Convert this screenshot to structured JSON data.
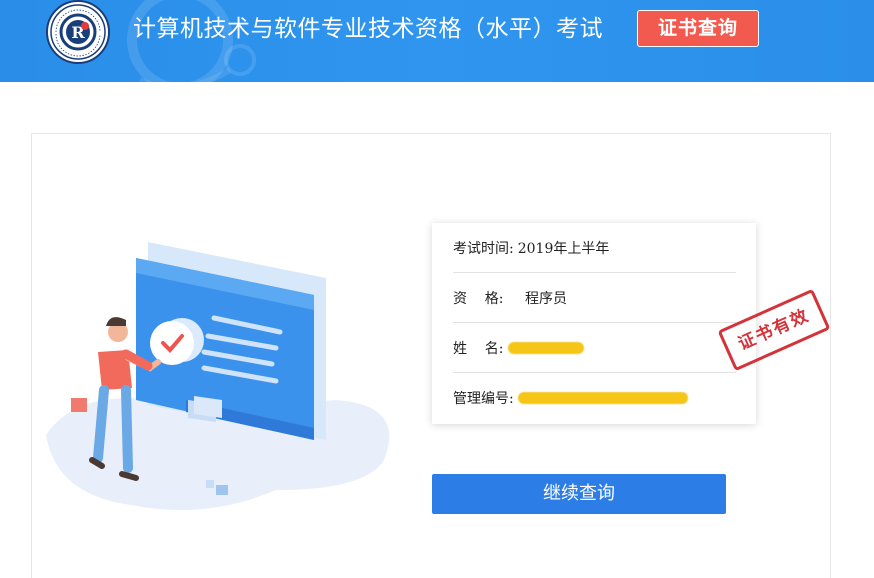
{
  "header": {
    "logo_icon": "exam-center-seal-logo",
    "title": "计算机技术与软件专业技术资格（水平）考试",
    "cert_query_button": "证书查询",
    "background_color": "#2f95ef",
    "button_color": "#f35a4f"
  },
  "illustration": {
    "icon": "person-at-screen-checkmark-illustration"
  },
  "info": {
    "rows": [
      {
        "label": "考试时间:",
        "value": "2019年上半年"
      },
      {
        "label": "资    格:",
        "value": "程序员"
      },
      {
        "label": "姓    名:",
        "value": ""
      },
      {
        "label": "管理编号:",
        "value": ""
      }
    ]
  },
  "stamp": {
    "text": "证书有效",
    "color": "#d2222a"
  },
  "continue_button": {
    "label": "继续查询",
    "color": "#2d7de6"
  }
}
